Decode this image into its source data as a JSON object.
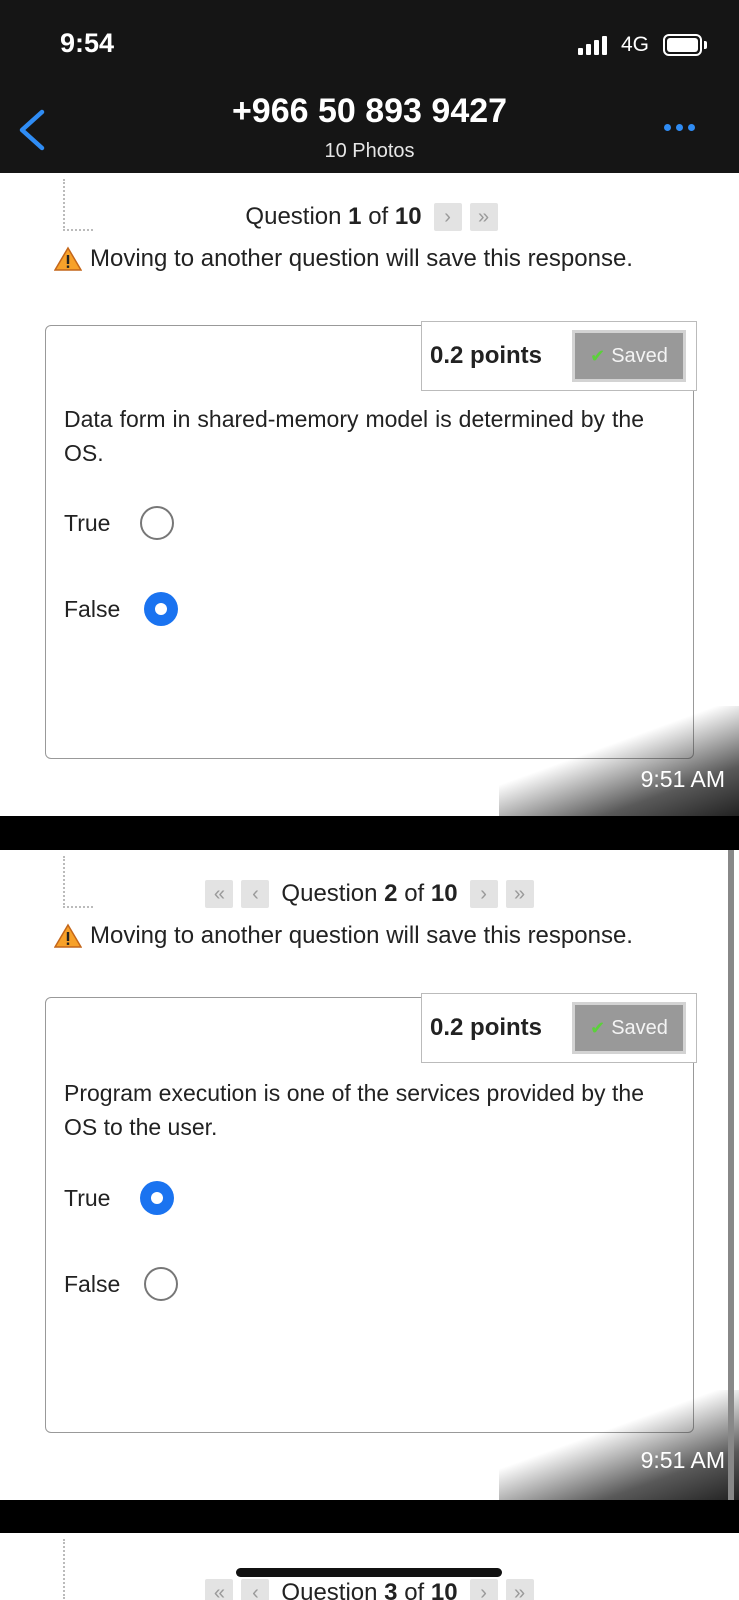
{
  "status": {
    "time": "9:54",
    "network": "4G"
  },
  "header": {
    "title": "+966 50 893 9427",
    "subtitle": "10 Photos"
  },
  "warning_text": "Moving to another question will save this response.",
  "questions": [
    {
      "nav_prefix": "Question",
      "number": "1",
      "of": "of",
      "total": "10",
      "points": "0.2 points",
      "saved": "Saved",
      "text": "Data form in shared-memory model is determined by the OS.",
      "options": [
        "True",
        "False"
      ],
      "selected": "False",
      "timestamp": "9:51 AM"
    },
    {
      "nav_prefix": "Question",
      "number": "2",
      "of": "of",
      "total": "10",
      "points": "0.2 points",
      "saved": "Saved",
      "text": "Program execution is one of the services provided by the OS to the user.",
      "options": [
        "True",
        "False"
      ],
      "selected": "True",
      "timestamp": "9:51 AM"
    },
    {
      "nav_prefix": "Question",
      "number": "3",
      "of": "of",
      "total": "10"
    }
  ]
}
